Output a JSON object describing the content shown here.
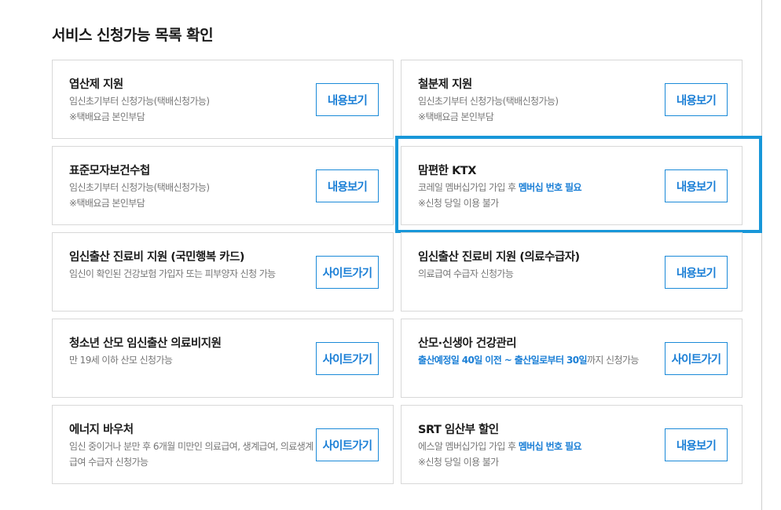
{
  "page_title": "서비스 신청가능 목록 확인",
  "colors": {
    "accent": "#1b7fd6",
    "selected_border": "#1897d9",
    "card_border": "#d8d8d8"
  },
  "cards": [
    {
      "name": "엽산제 지원",
      "desc1": "임신초기부터 신청가능(택배신청가능)",
      "desc2": "※택배요금 본인부담",
      "button": "내용보기"
    },
    {
      "name": "철분제 지원",
      "desc1": "임신초기부터 신청가능(택배신청가능)",
      "desc2": "※택배요금 본인부담",
      "button": "내용보기"
    },
    {
      "name": "표준모자보건수첩",
      "desc1": "임신초기부터 신청가능(택배신청가능)",
      "desc2": "※택배요금 본인부담",
      "button": "내용보기"
    },
    {
      "name": "맘편한 KTX",
      "desc1_plain": "코레일 멤버십가입 가입 후 ",
      "desc1_highlight": "멤버십 번호 필요",
      "desc2": "※신청 당일 이용 불가",
      "button": "내용보기"
    },
    {
      "name": "임신출산 진료비 지원 (국민행복 카드)",
      "desc1": "임신이 확인된 건강보험 가입자 또는 피부양자 신청 가능",
      "button": "사이트가기"
    },
    {
      "name": "임신출산 진료비 지원 (의료수급자)",
      "desc1": "의료급여 수급자 신청가능",
      "button": "내용보기"
    },
    {
      "name": "청소년 산모 임신출산 의료비지원",
      "desc1": "만 19세 이하 산모 신청가능",
      "button": "사이트가기"
    },
    {
      "name": "산모·신생아 건강관리",
      "desc1_highlight": "출산예정일 40일 이전 ~ 출산일로부터 30일",
      "desc1_plain": "까지 신청가능",
      "button": "사이트가기"
    },
    {
      "name": "에너지 바우처",
      "desc1": "임신 중이거나 분만 후 6개월 미만인 의료급여, 생계급여, 의료생계급여 수급자 신청가능",
      "button": "사이트가기"
    },
    {
      "name": "SRT 임산부 할인",
      "desc1_plain": "에스알 멤버십가입 가입 후 ",
      "desc1_highlight": "멤버십 번호 필요",
      "desc2": "※신청 당일 이용 불가",
      "button": "내용보기"
    }
  ]
}
